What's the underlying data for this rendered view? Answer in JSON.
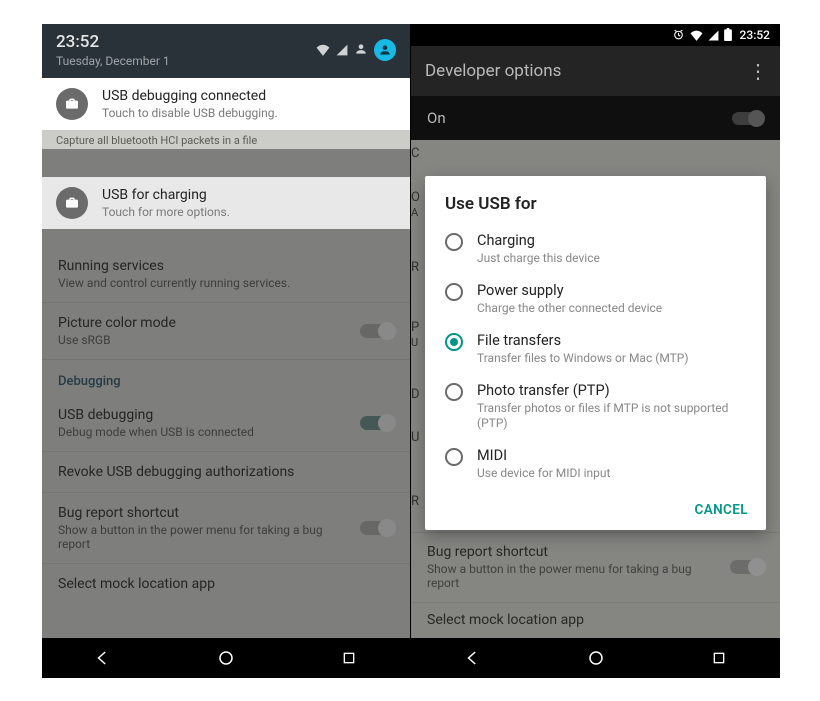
{
  "left": {
    "status": {
      "time": "23:52",
      "date": "Tuesday, December 1"
    },
    "notifications": {
      "usb_debug": {
        "title": "USB debugging connected",
        "subtitle": "Touch to disable USB debugging."
      },
      "between": "Capture all bluetooth HCI packets in a file",
      "usb_charging": {
        "title": "USB for charging",
        "subtitle": "Touch for more options."
      }
    },
    "settings": {
      "running": {
        "title": "Running services",
        "subtitle": "View and control currently running services."
      },
      "picture": {
        "title": "Picture color mode",
        "subtitle": "Use sRGB"
      },
      "debugging_header": "Debugging",
      "usb_debug": {
        "title": "USB debugging",
        "subtitle": "Debug mode when USB is connected"
      },
      "revoke": {
        "title": "Revoke USB debugging authorizations"
      },
      "bug": {
        "title": "Bug report shortcut",
        "subtitle": "Show a button in the power menu for taking a bug report"
      },
      "mock": {
        "title": "Select mock location app"
      }
    }
  },
  "right": {
    "statusbar": {
      "time": "23:52"
    },
    "appbar": {
      "title": "Developer options"
    },
    "switchrow": {
      "label": "On"
    },
    "bg_settings": {
      "bug": {
        "title": "Bug report shortcut",
        "subtitle": "Show a button in the power menu for taking a bug report"
      },
      "mock": {
        "title": "Select mock location app"
      }
    },
    "peek": {
      "c": "C",
      "o": "O",
      "a": "A",
      "r": "R",
      "p": "P",
      "u2": "U",
      "d": "D",
      "u": "U",
      "r2": "R"
    },
    "dialog": {
      "title": "Use USB for",
      "options": [
        {
          "title": "Charging",
          "subtitle": "Just charge this device",
          "checked": false
        },
        {
          "title": "Power supply",
          "subtitle": "Charge the other connected device",
          "checked": false
        },
        {
          "title": "File transfers",
          "subtitle": "Transfer files to Windows or Mac (MTP)",
          "checked": true
        },
        {
          "title": "Photo transfer (PTP)",
          "subtitle": "Transfer photos or files if MTP is not supported (PTP)",
          "checked": false
        },
        {
          "title": "MIDI",
          "subtitle": "Use device for MIDI input",
          "checked": false
        }
      ],
      "cancel": "CANCEL"
    }
  }
}
